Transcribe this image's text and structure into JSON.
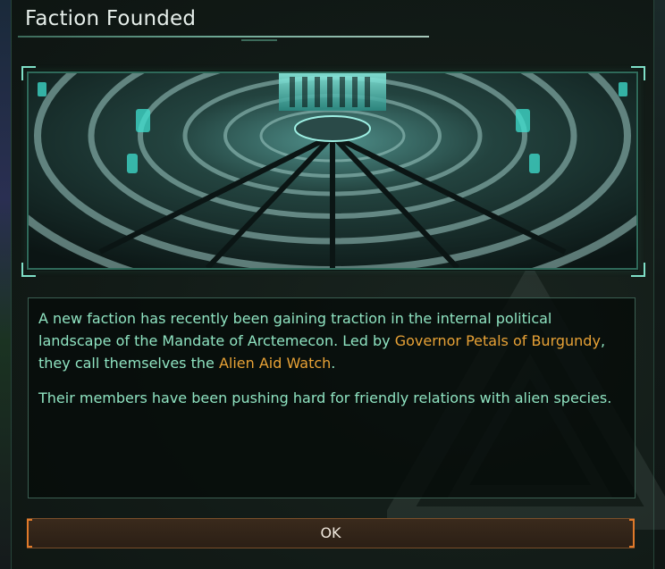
{
  "dialog": {
    "title": "Faction Founded",
    "image": {
      "icon": "senate-chamber-illustration"
    },
    "body": {
      "p1_a": "A new faction has recently been gaining traction in the internal political landscape of the Mandate of Arctemecon. Led by ",
      "p1_leader": "Governor Petals of Burgundy",
      "p1_b": ", they call themselves the ",
      "p1_faction": "Alien Aid Watch",
      "p1_c": ".",
      "p2": "Their members have been pushing hard for friendly relations with alien species."
    },
    "ok_label": "OK"
  },
  "colors": {
    "body_text": "#8fe3c1",
    "highlight": "#e8a236",
    "frame": "#2f6a5a",
    "button_accent": "#e07a2a"
  }
}
